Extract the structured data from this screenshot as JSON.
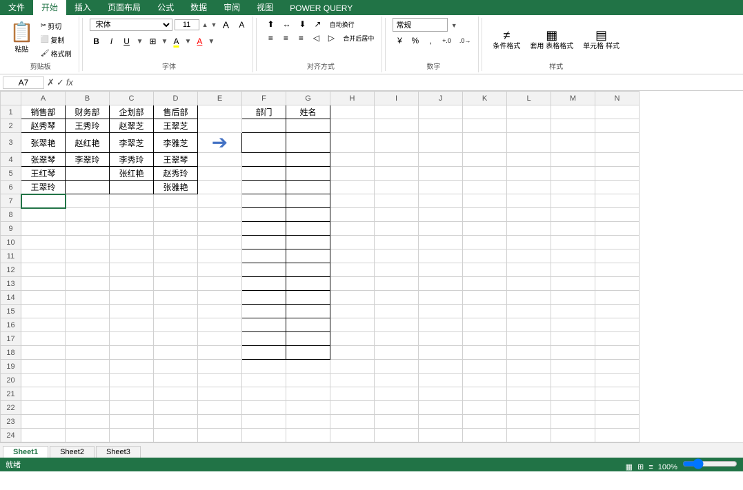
{
  "ribbon": {
    "tabs": [
      "文件",
      "开始",
      "插入",
      "页面布局",
      "公式",
      "数据",
      "审阅",
      "视图",
      "POWER QUERY"
    ],
    "active_tab": "开始",
    "groups": {
      "clipboard": {
        "label": "剪贴板",
        "paste": "粘贴",
        "cut": "✂ 剪切",
        "copy": "□ 复制",
        "format_painter": "🖌 格式刷"
      },
      "font": {
        "label": "字体",
        "font_name": "宋体",
        "font_size": "11",
        "bold": "B",
        "italic": "I",
        "underline": "U",
        "border_icon": "⊞",
        "fill_icon": "A",
        "font_color_icon": "A"
      },
      "alignment": {
        "label": "对齐方式",
        "wrap_text": "自动换行",
        "merge_center": "合并后居中",
        "align_left": "≡",
        "align_center": "≡",
        "align_right": "≡",
        "indent_dec": "◁",
        "indent_inc": "▷"
      },
      "number": {
        "label": "数字",
        "format": "常规",
        "percent": "%",
        "comma": ",",
        "dec_inc": ".0→",
        "dec_dec": "←.0"
      },
      "styles": {
        "label": "样式",
        "conditional": "条件格式",
        "table": "套用\n表格格式",
        "cell_styles": "单元格\n样式"
      }
    }
  },
  "formula_bar": {
    "cell_ref": "A7",
    "formula": ""
  },
  "columns": [
    "A",
    "B",
    "C",
    "D",
    "E",
    "F",
    "G",
    "H",
    "I",
    "J",
    "K",
    "L",
    "M",
    "N"
  ],
  "rows": [
    1,
    2,
    3,
    4,
    5,
    6,
    7,
    8,
    9,
    10,
    11,
    12,
    13,
    14,
    15,
    16,
    17,
    18,
    19,
    20,
    21,
    22,
    23,
    24
  ],
  "data": {
    "A1": "销售部",
    "B1": "财务部",
    "C1": "企划部",
    "D1": "售后部",
    "A2": "赵秀琴",
    "B2": "王秀玲",
    "C2": "赵翠芝",
    "D2": "王翠芝",
    "A3": "张翠艳",
    "B3": "赵红艳",
    "C3": "李翠芝",
    "D3": "李雅芝",
    "A4": "张翠琴",
    "B4": "李翠玲",
    "C4": "李秀玲",
    "D4": "王翠琴",
    "A5": "王红琴",
    "C5": "张红艳",
    "D5": "赵秀玲",
    "A6": "王翠玲",
    "D6": "张雅艳",
    "F1": "部门",
    "G1": "姓名"
  },
  "selected_cell": "A7",
  "arrow_col": "E",
  "arrow_row": 3,
  "sheet_tabs": [
    "Sheet1",
    "Sheet2",
    "Sheet3"
  ],
  "active_sheet": "Sheet1",
  "status": "就绪"
}
